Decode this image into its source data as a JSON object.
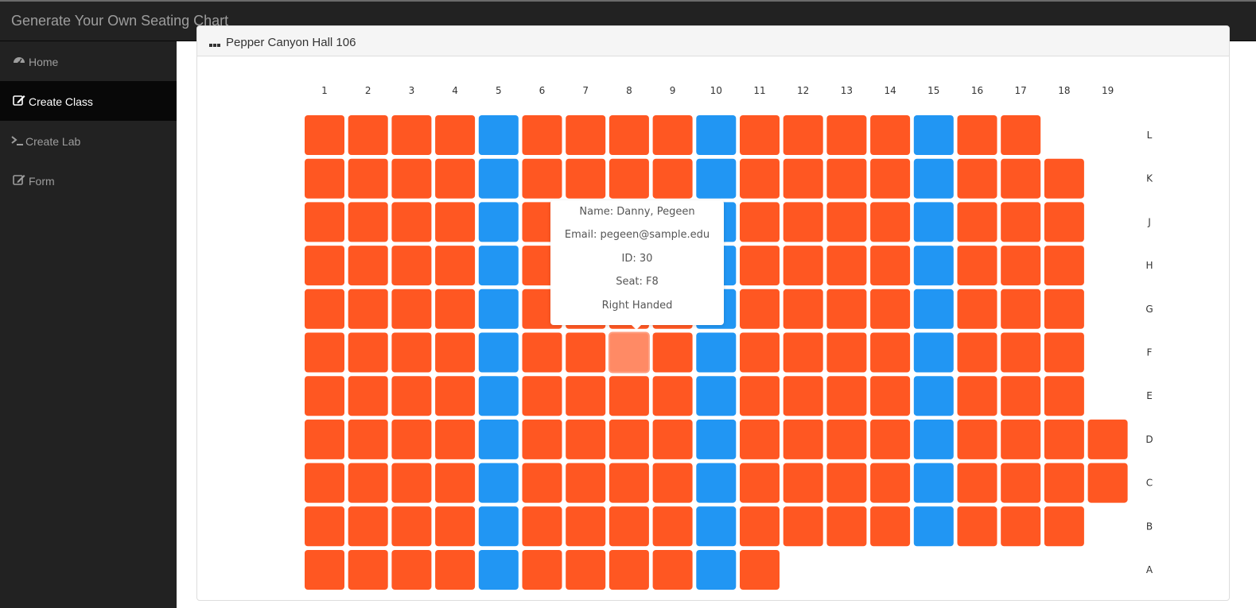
{
  "app": {
    "title": "Generate Your Own Seating Chart"
  },
  "sidebar": {
    "items": [
      {
        "label": "Home",
        "icon": "dashboard-icon",
        "active": false
      },
      {
        "label": "Create Class",
        "icon": "edit-icon",
        "active": true
      },
      {
        "label": "Create Lab",
        "icon": "terminal-icon",
        "active": false
      },
      {
        "label": "Form",
        "icon": "edit-icon",
        "active": false
      }
    ]
  },
  "panel": {
    "title": "Pepper Canyon Hall 106",
    "icon": "grid-icon"
  },
  "seating": {
    "columns": [
      "1",
      "2",
      "3",
      "4",
      "5",
      "6",
      "7",
      "8",
      "9",
      "10",
      "11",
      "12",
      "13",
      "14",
      "15",
      "16",
      "17",
      "18",
      "19"
    ],
    "rows": [
      {
        "label": "L",
        "seats": 17
      },
      {
        "label": "K",
        "seats": 18
      },
      {
        "label": "J",
        "seats": 18
      },
      {
        "label": "H",
        "seats": 18
      },
      {
        "label": "G",
        "seats": 18
      },
      {
        "label": "F",
        "seats": 18
      },
      {
        "label": "E",
        "seats": 18
      },
      {
        "label": "D",
        "seats": 19
      },
      {
        "label": "C",
        "seats": 19
      },
      {
        "label": "B",
        "seats": 18
      },
      {
        "label": "A",
        "seats": 11
      }
    ],
    "aisle_columns": [
      5,
      10,
      15
    ],
    "highlighted_seat": {
      "row": "F",
      "column": 8
    },
    "colors": {
      "seat": "#ff5722",
      "aisle": "#2196f3",
      "highlight": "#ff8a65"
    }
  },
  "tooltip": {
    "name": "Name: Danny, Pegeen",
    "email": "Email: pegeen@sample.edu",
    "id": "ID: 30",
    "seat": "Seat: F8",
    "handedness": "Right Handed"
  }
}
